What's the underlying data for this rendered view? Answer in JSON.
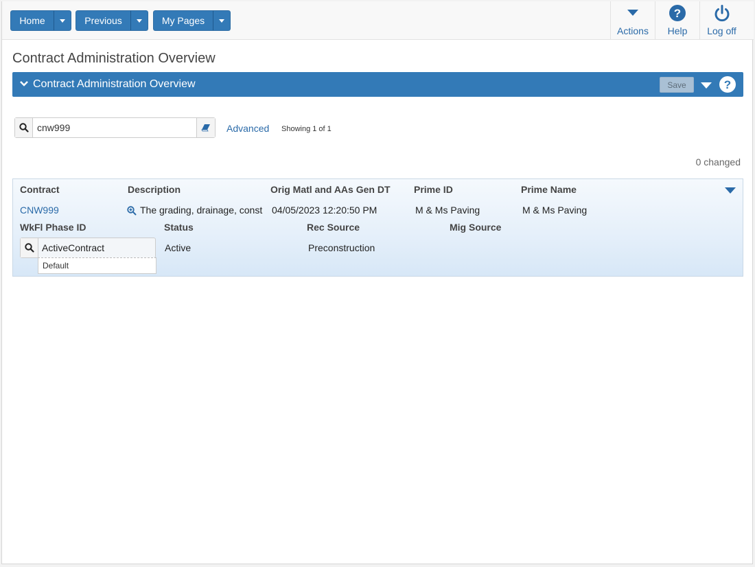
{
  "nav": {
    "home": "Home",
    "previous": "Previous",
    "my_pages": "My Pages",
    "actions": "Actions",
    "help": "Help",
    "log_off": "Log off"
  },
  "page": {
    "title": "Contract Administration Overview"
  },
  "panel": {
    "title": "Contract Administration Overview",
    "save_label": "Save"
  },
  "search": {
    "value": "cnw999",
    "advanced_label": "Advanced",
    "showing": "Showing 1 of 1",
    "changed": "0 changed"
  },
  "grid": {
    "headers": {
      "contract": "Contract",
      "description": "Description",
      "orig_matl": "Orig Matl and AAs Gen DT",
      "prime_id": "Prime ID",
      "prime_name": "Prime Name",
      "wkfl_phase": "WkFl Phase ID",
      "status": "Status",
      "rec_source": "Rec Source",
      "mig_source": "Mig Source"
    },
    "row": {
      "contract": "CNW999",
      "description": "The grading, drainage, const",
      "orig_matl": "04/05/2023 12:20:50 PM",
      "prime_id": "M & Ms Paving",
      "prime_name": "M & Ms Paving",
      "wkfl_phase": "ActiveContract",
      "wkfl_phase_sub": "Default",
      "status": "Active",
      "rec_source": "Preconstruction",
      "mig_source": ""
    }
  },
  "colors": {
    "primary": "#337ab7",
    "link": "#2a6aa8"
  }
}
